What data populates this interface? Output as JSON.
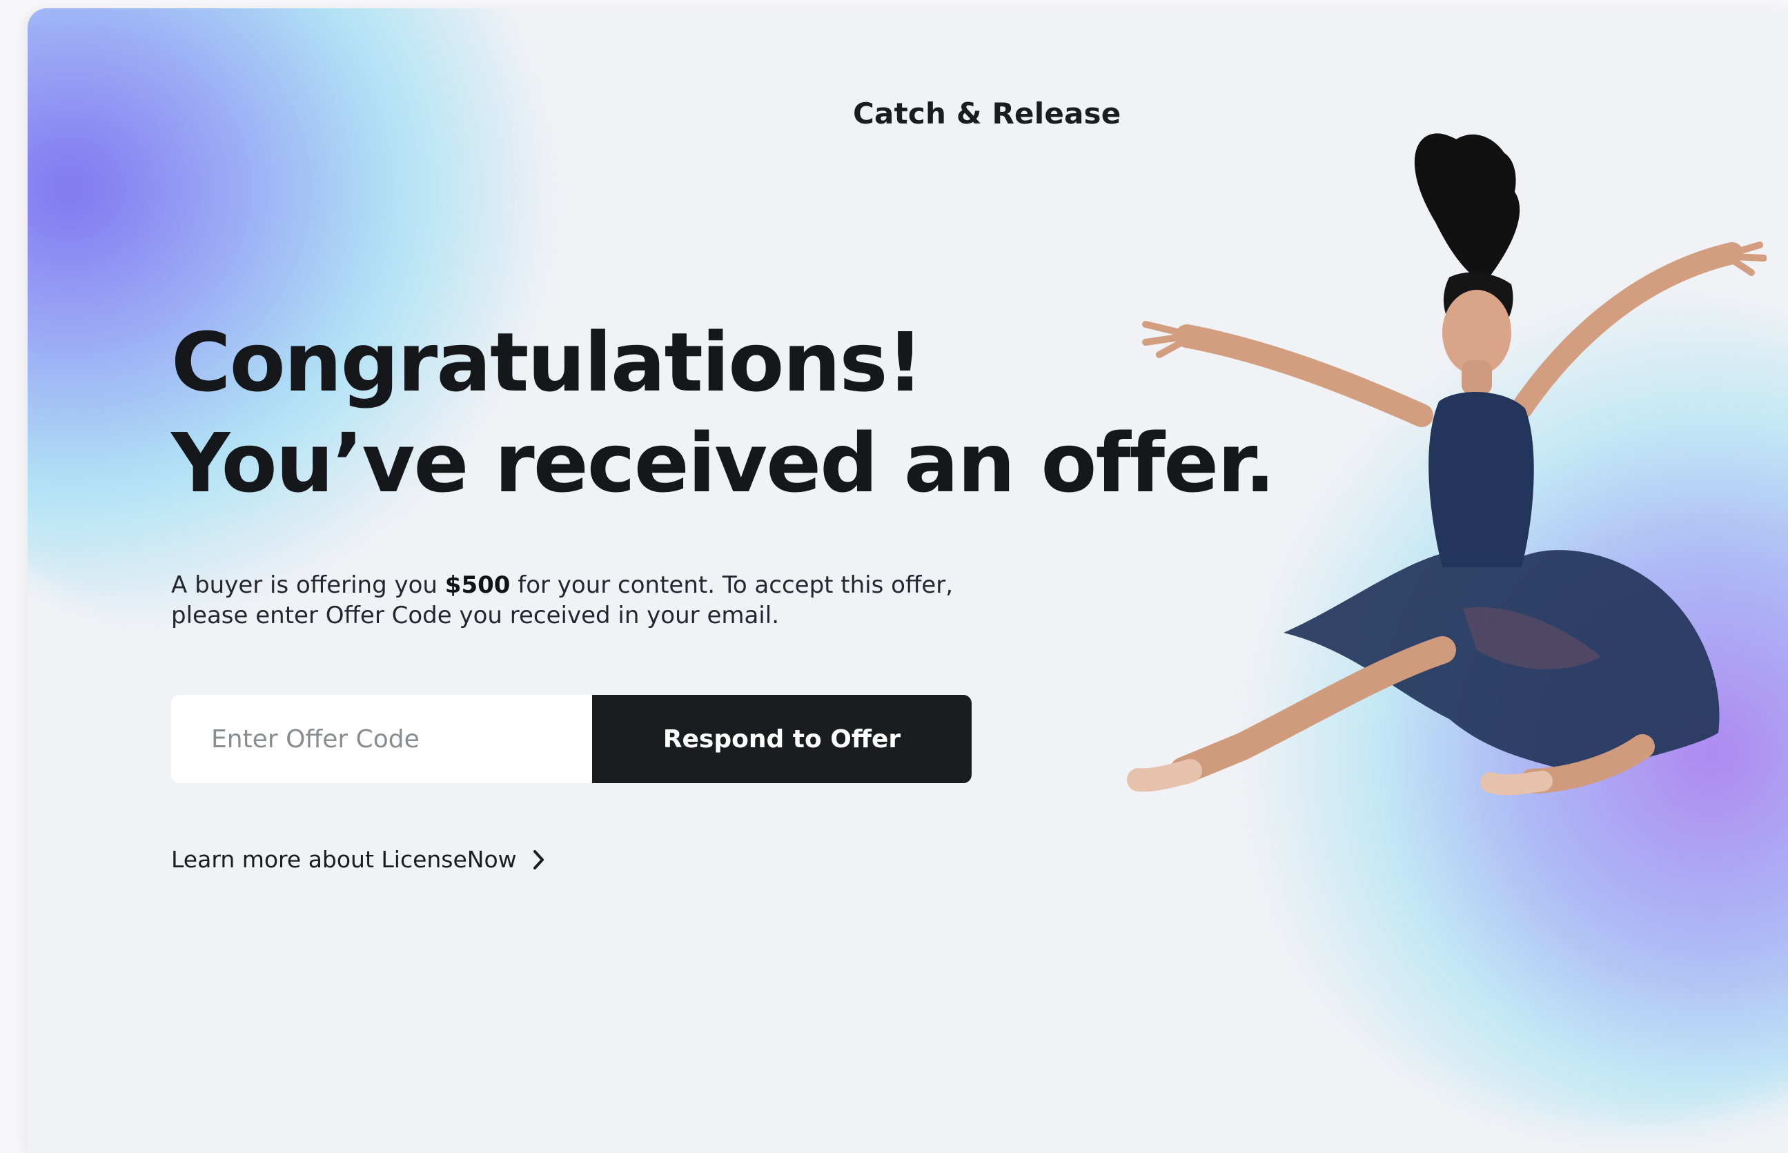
{
  "brand": {
    "name": "Catch & Release"
  },
  "hero": {
    "headline_line1": "Congratulations!",
    "headline_line2": "You’ve received an offer."
  },
  "description": {
    "prefix": "A buyer is offering you ",
    "amount": "$500",
    "suffix_line1": " for your content. To accept this offer,",
    "line2": "please enter Offer Code you received in your email."
  },
  "form": {
    "code_placeholder": "Enter Offer Code",
    "code_value": "",
    "submit_label": "Respond to Offer"
  },
  "learn_more": {
    "label": "Learn more about LicenseNow",
    "icon": "chevron-right-icon"
  },
  "hero_image": {
    "subject": "dancer-photo"
  },
  "colors": {
    "background": "#f1f2f5",
    "text_primary": "#16171b",
    "button_bg": "#1b1c20",
    "button_text": "#ffffff",
    "gradient_violet": "#8a86f0",
    "gradient_cyan": "#a6e0f5",
    "gradient_purple": "#aa82f0",
    "dress": "#23355a"
  }
}
